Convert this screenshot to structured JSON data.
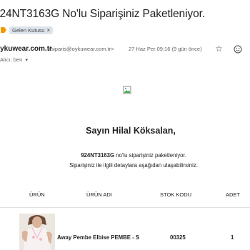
{
  "email": {
    "subject": "924NT3163G No'lu Siparişiniz Paketleniyor.",
    "label": "Gelen Kutusu",
    "label_close": "×",
    "sender_name": "oykuwear.com.tr",
    "sender_address": "<siparis@oykuwear.com.tr>",
    "date": "27 Haz Per 09:16 (9 gün önce)",
    "to": "Alıcı: ben"
  },
  "body": {
    "greeting": "Sayın Hilal Köksalan,",
    "order_code": "924NT3163G",
    "line1_rest": " no'lu siparişiniz paketleniyor.",
    "line2": "Siparişiniz ile ilgili detaylara aşağıdan ulaşabilirsiniz."
  },
  "table": {
    "headers": [
      "ÜRÜN",
      "ÜRÜN ADI",
      "STOK KODU",
      "ADET"
    ],
    "rows": [
      {
        "name": "Away Pembe Elbise PEMBE - S",
        "stock_code": "00325",
        "quantity": "1"
      }
    ]
  },
  "icons": {
    "label": "label-arrow-icon",
    "star": "star-icon",
    "emoji": "emoji-smile-icon",
    "broken_image": "broken-image-icon"
  },
  "colors": {
    "label_icon": "#f29900",
    "chip_bg": "#dde3ea"
  }
}
